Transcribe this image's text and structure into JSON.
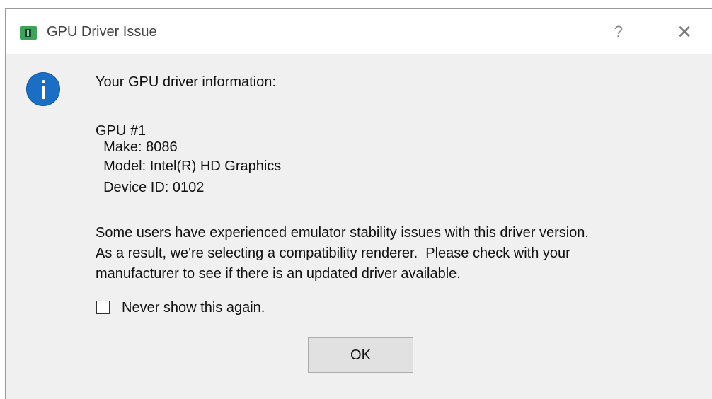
{
  "window": {
    "title": "GPU Driver Issue",
    "help_icon": "question-mark-icon",
    "close_icon": "close-icon",
    "app_icon": "android-emulator-icon"
  },
  "message": {
    "icon": "info-icon",
    "heading": "Your GPU driver information:",
    "gpu_header": "GPU #1",
    "make": "  Make: 8086",
    "model": "  Model: Intel(R) HD Graphics",
    "device_id": "  Device ID: 0102",
    "body_lines": [
      "Some users have experienced emulator stability issues with this driver version.",
      "As a result, we're selecting a compatibility renderer.  Please check with your",
      "manufacturer to see if there is an updated driver available."
    ]
  },
  "checkbox": {
    "label": "Never show this again.",
    "checked": false
  },
  "buttons": {
    "ok_label": "OK"
  }
}
